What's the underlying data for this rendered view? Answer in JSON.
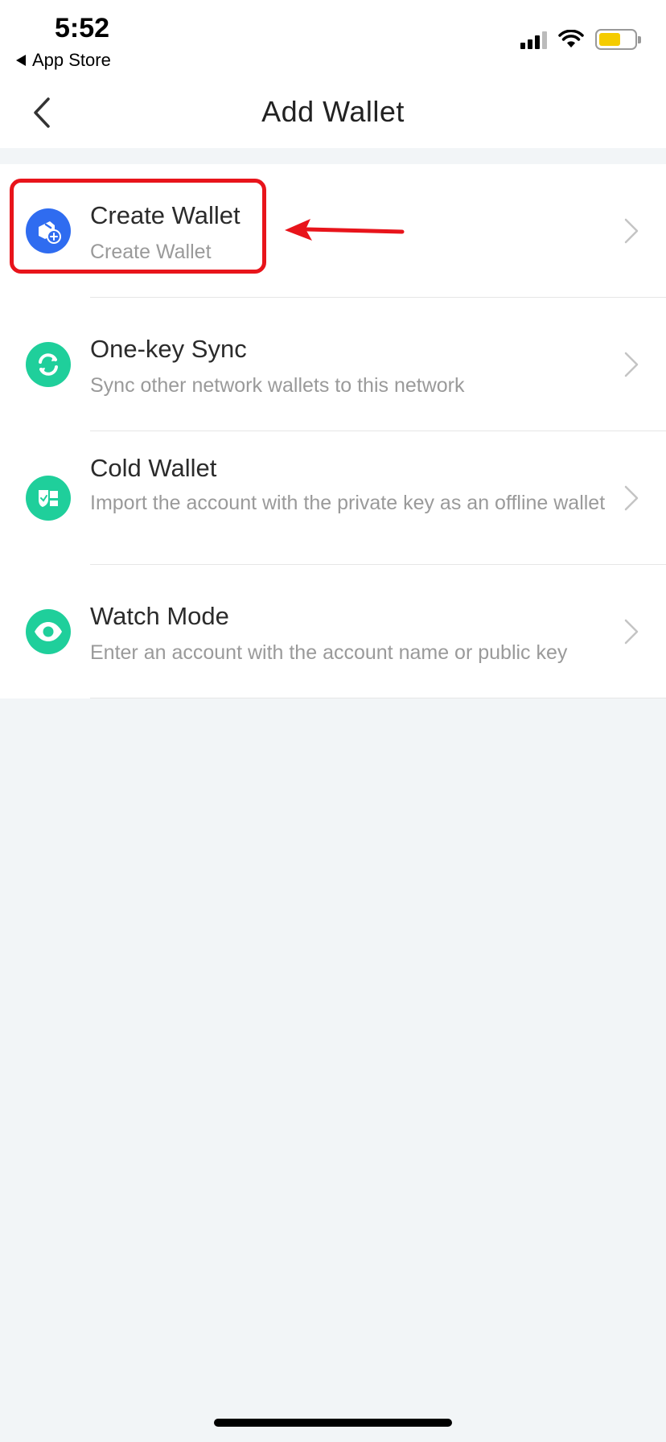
{
  "status_bar": {
    "time": "5:52",
    "back_label": "App Store",
    "battery_color": "#f5cc00"
  },
  "nav": {
    "title": "Add Wallet",
    "back_icon": "chevron-left-icon"
  },
  "items": [
    {
      "title": "Create Wallet",
      "subtitle": "Create Wallet",
      "icon": "wallet-add-icon",
      "icon_color": "#2f6cf0"
    },
    {
      "title": "One-key Sync",
      "subtitle": "Sync other network wallets to this network",
      "icon": "sync-icon",
      "icon_color": "#1fcf9b"
    },
    {
      "title": "Cold Wallet",
      "subtitle": "Import the account with the private key as an offline wallet",
      "icon": "shield-wallet-icon",
      "icon_color": "#1fcf9b"
    },
    {
      "title": "Watch Mode",
      "subtitle": "Enter an account with the account name or public key",
      "icon": "eye-icon",
      "icon_color": "#1fcf9b"
    }
  ],
  "annotation": {
    "highlight_color": "#e8141b"
  }
}
